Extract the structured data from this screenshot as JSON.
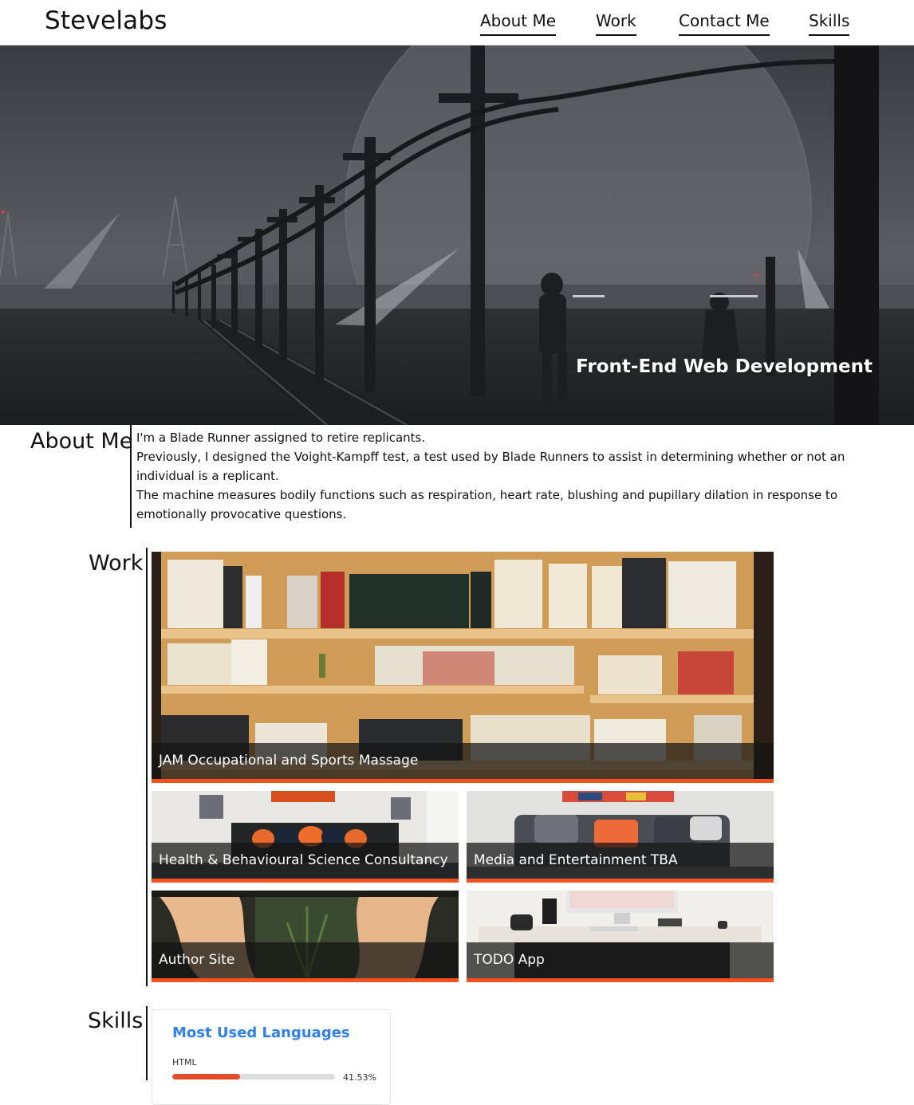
{
  "header": {
    "brand": "Stevelabs",
    "nav": [
      {
        "label": "About Me"
      },
      {
        "label": "Work"
      },
      {
        "label": "Contact Me"
      },
      {
        "label": "Skills"
      }
    ]
  },
  "hero": {
    "tagline": "Front-End Web Development"
  },
  "about": {
    "title": "About Me",
    "paragraphs": [
      "I'm a Blade Runner assigned to retire replicants.",
      "Previously, I designed the Voight-Kampff test, a test used by Blade Runners to assist in determining whether or not an individual is a replicant.",
      "The machine measures bodily functions such as respiration, heart rate, blushing and pupillary dilation in response to emotionally provocative questions."
    ]
  },
  "work": {
    "title": "Work",
    "projects": [
      {
        "name": "JAM Occupational and Sports Massage"
      },
      {
        "name": "Health & Behavioural Science Consultancy"
      },
      {
        "name": "Media and Entertainment TBA"
      },
      {
        "name": "Author Site"
      },
      {
        "name": "TODO App"
      }
    ]
  },
  "skills": {
    "title": "Skills",
    "card_title": "Most Used Languages",
    "languages": [
      {
        "name": "HTML",
        "percent_label": "41.53%",
        "fraction": 0.4153,
        "color": "#e34c26"
      }
    ]
  },
  "colors": {
    "accent": "#f4511e",
    "link_blue": "#2f80ed"
  }
}
